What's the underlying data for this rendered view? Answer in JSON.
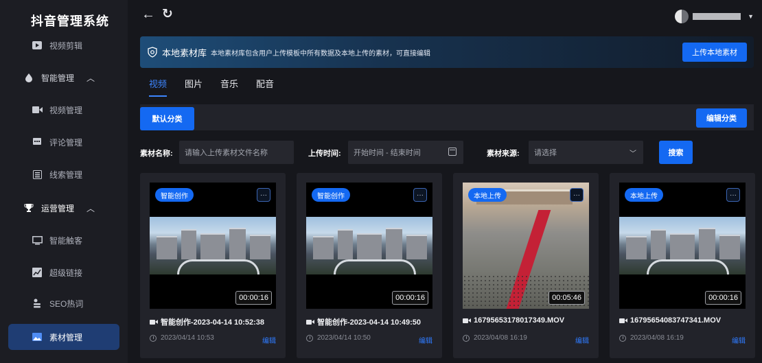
{
  "app": {
    "title": "抖音管理系统"
  },
  "sidebar": {
    "items": [
      {
        "label": "视频剪辑",
        "icon": "play-square-icon"
      },
      {
        "label": "智能管理",
        "icon": "drop-icon",
        "chevron": "chevron-up-icon"
      },
      {
        "label": "视频管理",
        "icon": "video-camera-icon"
      },
      {
        "label": "评论管理",
        "icon": "comment-icon"
      },
      {
        "label": "线索管理",
        "icon": "clue-list-icon"
      },
      {
        "label": "运营管理",
        "icon": "trophy-icon",
        "chevron": "chevron-up-icon"
      },
      {
        "label": "智能触客",
        "icon": "monitor-icon"
      },
      {
        "label": "超级链接",
        "icon": "chart-link-icon"
      },
      {
        "label": "SEO热词",
        "icon": "seo-icon"
      },
      {
        "label": "素材管理",
        "icon": "image-icon",
        "selected": true
      }
    ]
  },
  "topbar": {
    "back_icon": "←",
    "refresh_icon": "↻",
    "user_caret": "▼"
  },
  "banner": {
    "title": "本地素材库",
    "description": "本地素材库包含用户上传模板中所有数据及本地上传的素材，可直接编辑",
    "upload_button": "上传本地素材"
  },
  "tabs": [
    {
      "label": "视频",
      "active": true
    },
    {
      "label": "图片",
      "active": false
    },
    {
      "label": "音乐",
      "active": false
    },
    {
      "label": "配音",
      "active": false
    }
  ],
  "category": {
    "default_label": "默认分类",
    "edit_button": "编辑分类"
  },
  "filters": {
    "name_label": "素材名称:",
    "name_placeholder": "请输入上传素材文件名称",
    "time_label": "上传时间:",
    "time_placeholder": "开始时间 - 结束时间",
    "source_label": "素材来源:",
    "source_placeholder": "请选择",
    "search_button": "搜索"
  },
  "cards": [
    {
      "badge": "智能创作",
      "more": "···",
      "duration": "00:00:16",
      "title": "智能创作-2023-04-14 10:52:38",
      "date": "2023/04/14 10:53",
      "edit": "编辑"
    },
    {
      "badge": "智能创作",
      "more": "···",
      "duration": "00:00:16",
      "title": "智能创作-2023-04-14 10:49:50",
      "date": "2023/04/14 10:50",
      "edit": "编辑"
    },
    {
      "badge": "本地上传",
      "more": "···",
      "duration": "00:05:46",
      "title": "16795653178017349.MOV",
      "date": "2023/04/08 16:19",
      "edit": "编辑"
    },
    {
      "badge": "本地上传",
      "more": "···",
      "duration": "00:00:16",
      "title": "16795654083747341.MOV",
      "date": "2023/04/08 16:19",
      "edit": "编辑"
    }
  ],
  "colors": {
    "accent": "#1469f2",
    "sidebar_selected": "#1f3d73",
    "background": "#16171c"
  }
}
